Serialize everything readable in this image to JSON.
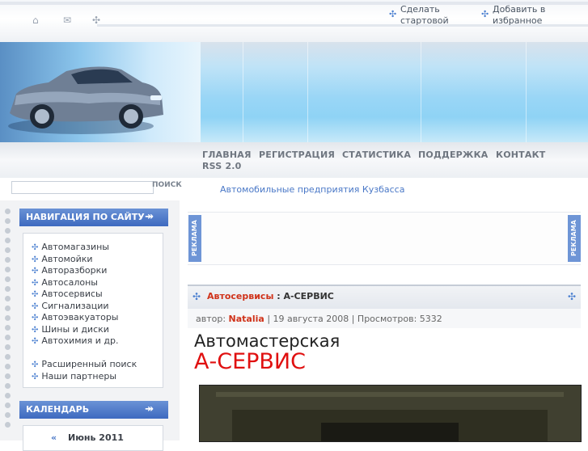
{
  "top_links": {
    "start_line1": "Сделать",
    "start_line2": "стартовой",
    "fav_line1": "Добавить в",
    "fav_line2": "избранное"
  },
  "icons": {
    "home": "home-icon",
    "mail": "mail-icon",
    "sitemap": "sitemap-icon",
    "bullet": "four-arrows-icon"
  },
  "nav": {
    "items": [
      "ГЛАВНАЯ",
      "РЕГИСТРАЦИЯ",
      "СТАТИСТИКА",
      "ПОДДЕРЖКА",
      "КОНТАКТ",
      "RSS 2.0"
    ]
  },
  "search": {
    "value": "",
    "button_label": "ПОИСК"
  },
  "subtitle": "Автомобильные предприятия Кузбасса",
  "sidebar": {
    "nav_title": "НАВИГАЦИЯ ПО САЙТУ",
    "arrow": "↠",
    "items": [
      "Автомагазины",
      "Автомойки",
      "Авторазборки",
      "Автосалоны",
      "Автосервисы",
      "Сигнализации",
      "Автоэвакуаторы",
      "Шины и диски",
      "Автохимия и др."
    ],
    "extra_items": [
      "Расширенный поиск",
      "Наши партнеры"
    ],
    "calendar_title": "КАЛЕНДАРЬ",
    "calendar_prev": "«",
    "calendar_month": "Июнь 2011"
  },
  "ad": {
    "label": "РЕКЛАМА"
  },
  "post": {
    "category": "Автосервисы",
    "separator": " : ",
    "title": "А-СЕРВИС",
    "meta_author_label": "автор: ",
    "author": "Natalia",
    "meta_rest": " | 19 августа 2008 | Просмотров: 5332",
    "heading1": "Автомастерская",
    "heading2": "А-СЕРВИС"
  },
  "colors": {
    "accent_blue": "#4a78c7",
    "red": "#e01010",
    "header_blue": "#3e6ac0"
  }
}
